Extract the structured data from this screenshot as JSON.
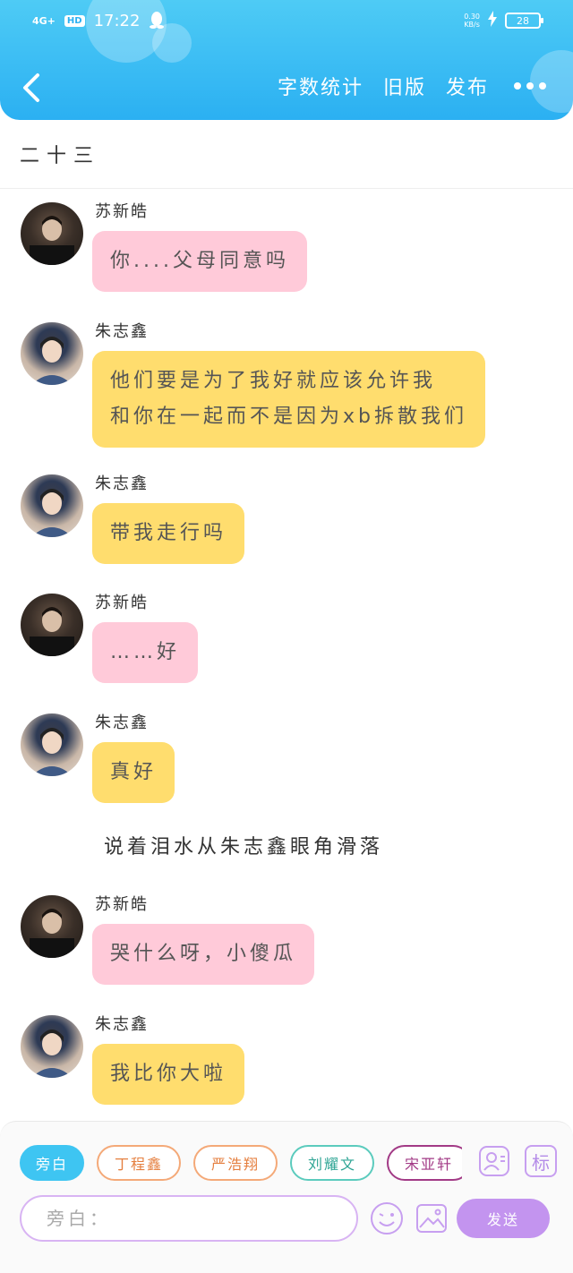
{
  "status_bar": {
    "network": "4G+",
    "hd": "HD",
    "time": "17:22",
    "speed_value": "0.30",
    "speed_unit": "KB/s",
    "battery": "28"
  },
  "nav": {
    "word_count": "字数统计",
    "old_version": "旧版",
    "publish": "发布"
  },
  "chapter": {
    "title": "二十三"
  },
  "messages": [
    {
      "sender": "苏新皓",
      "text": "你....父母同意吗",
      "color": "pink"
    },
    {
      "sender": "朱志鑫",
      "lines": [
        "他们要是为了我好就应该允许我",
        "和你在一起而不是因为xb拆散我们"
      ],
      "color": "yellow"
    },
    {
      "sender": "朱志鑫",
      "text": "带我走行吗",
      "color": "yellow"
    },
    {
      "sender": "苏新皓",
      "text": "……好",
      "color": "pink"
    },
    {
      "sender": "朱志鑫",
      "text": "真好",
      "color": "yellow"
    },
    {
      "sender": "苏新皓",
      "text": "哭什么呀，小傻瓜",
      "color": "pink"
    },
    {
      "sender": "朱志鑫",
      "text": "我比你大啦",
      "color": "yellow"
    }
  ],
  "narration": "说着泪水从朱志鑫眼角滑落",
  "roles": [
    {
      "label": "旁白",
      "active": true
    },
    {
      "label": "丁程鑫"
    },
    {
      "label": "严浩翔"
    },
    {
      "label": "刘耀文"
    },
    {
      "label": "宋亚轩"
    }
  ],
  "mark_button": "标",
  "input": {
    "placeholder": "旁白："
  },
  "send_button": "发送",
  "colors": {
    "header": "#2bb0f2",
    "pink_bubble": "#ffcad9",
    "yellow_bubble": "#ffdd6e",
    "send": "#c394ef"
  }
}
